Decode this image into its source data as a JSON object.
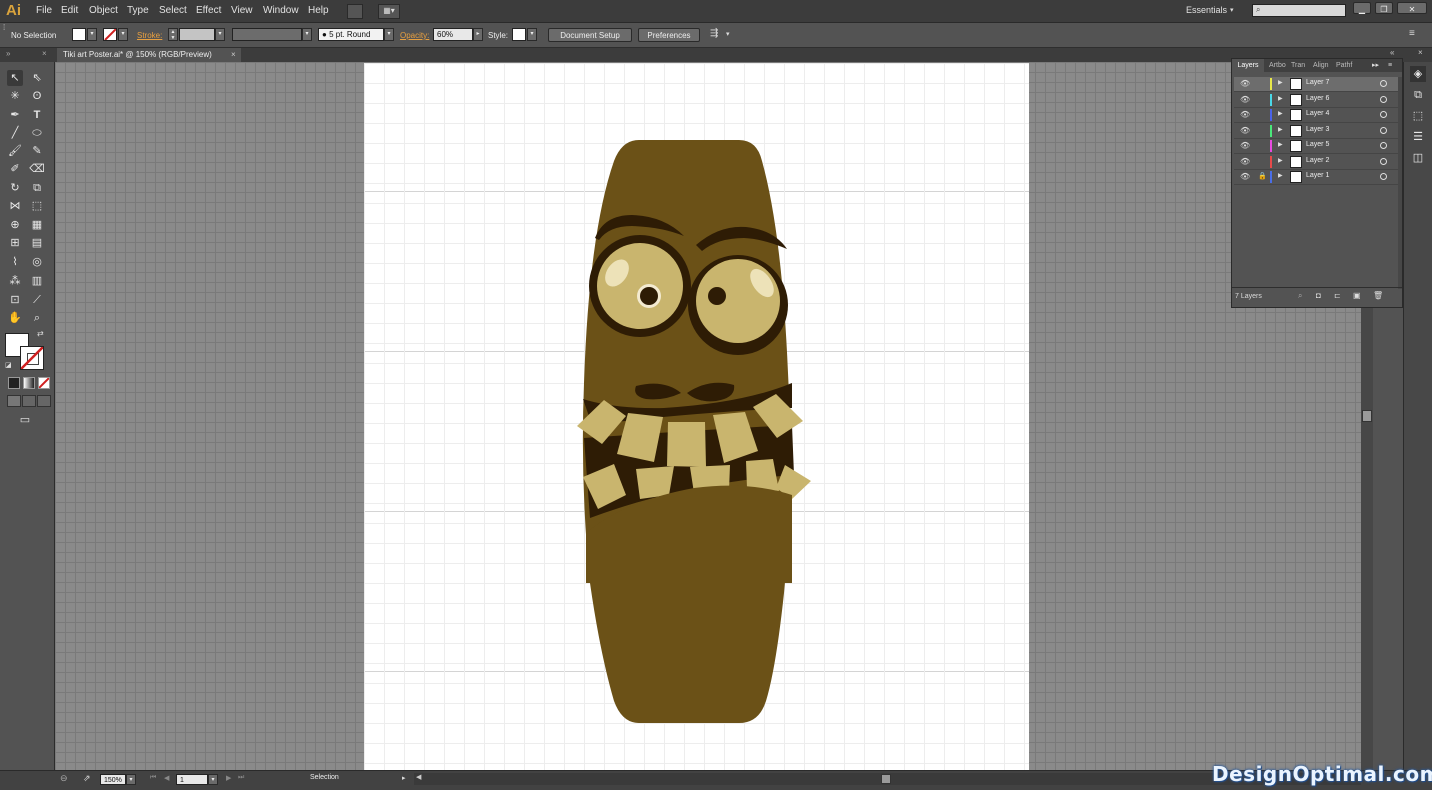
{
  "app": {
    "logo": "Ai",
    "workspace": "Essentials"
  },
  "menu": [
    "File",
    "Edit",
    "Object",
    "Type",
    "Select",
    "Effect",
    "View",
    "Window",
    "Help"
  ],
  "control_bar": {
    "selection_state": "No Selection",
    "stroke_label": "Stroke:",
    "brush": "5 pt. Round",
    "opacity_label": "Opacity:",
    "opacity_value": "60%",
    "style_label": "Style:",
    "document_setup": "Document Setup",
    "preferences": "Preferences"
  },
  "document_tab": {
    "title": "Tiki art Poster.ai* @ 150% (RGB/Preview)",
    "close": "×"
  },
  "layers_panel": {
    "tabs": [
      "Layers",
      "Artbo",
      "Tran",
      "Align",
      "Pathf"
    ],
    "layers": [
      {
        "name": "Layer 7",
        "color": "#e8e84a",
        "selected": true,
        "locked": false
      },
      {
        "name": "Layer 6",
        "color": "#4ad8e8",
        "selected": false,
        "locked": false
      },
      {
        "name": "Layer 4",
        "color": "#4a62e8",
        "selected": false,
        "locked": false
      },
      {
        "name": "Layer 3",
        "color": "#4ae87a",
        "selected": false,
        "locked": false
      },
      {
        "name": "Layer 5",
        "color": "#e84ae0",
        "selected": false,
        "locked": false
      },
      {
        "name": "Layer 2",
        "color": "#e84a4a",
        "selected": false,
        "locked": false
      },
      {
        "name": "Layer 1",
        "color": "#4a6ee8",
        "selected": false,
        "locked": true
      }
    ],
    "count_label": "7 Layers"
  },
  "status_bar": {
    "zoom": "150%",
    "page": "1",
    "mode": "Selection"
  },
  "watermark": "DesignOptimal.com",
  "colors": {
    "tiki_body": "#6b5117",
    "tiki_dark": "#2e1c05",
    "tiki_light": "#c9b56e",
    "accent": "#d9a33c"
  }
}
